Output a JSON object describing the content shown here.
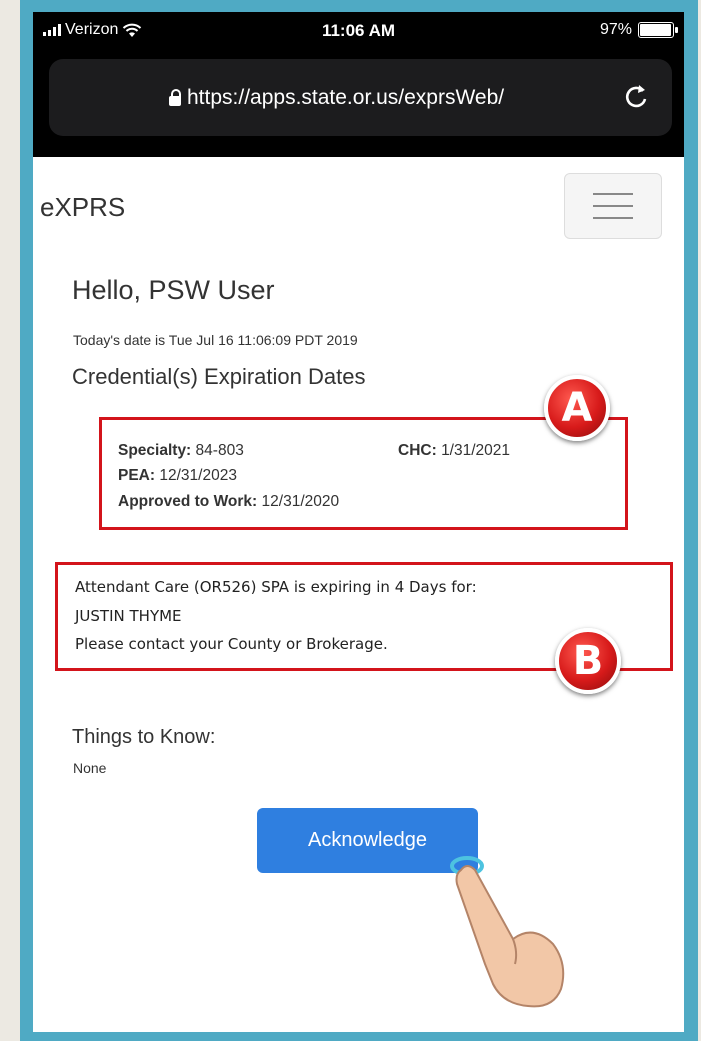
{
  "status_bar": {
    "carrier": "Verizon",
    "time": "11:06 AM",
    "battery": "97%"
  },
  "browser": {
    "url": "https://apps.state.or.us/exprsWeb/"
  },
  "navbar": {
    "brand": "eXPRS"
  },
  "main": {
    "greeting": "Hello, PSW User",
    "date": "Today's date is Tue Jul 16 11:06:09 PDT 2019",
    "credentials_title": "Credential(s) Expiration Dates",
    "credentials": {
      "specialty_label": "Specialty:",
      "specialty_value": "84-803",
      "chc_label": "CHC:",
      "chc_value": "1/31/2021",
      "pea_label": "PEA:",
      "pea_value": "12/31/2023",
      "approved_label": "Approved to Work:",
      "approved_value": "12/31/2020"
    },
    "notice": {
      "line1": "Attendant Care (OR526) SPA is expiring in 4 Days for:",
      "line2": "JUSTIN THYME",
      "line3": "Please contact your County or Brokerage."
    },
    "things_title": "Things to Know:",
    "things_value": "None",
    "acknowledge_label": "Acknowledge"
  },
  "annotations": {
    "marker_a": "A",
    "marker_b": "B"
  },
  "colors": {
    "frame": "#4faac4",
    "highlight_box": "#d3141b",
    "button": "#2f7fe0"
  }
}
